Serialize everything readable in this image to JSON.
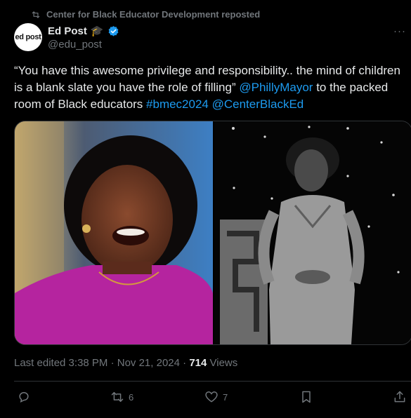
{
  "repost": {
    "text": "Center for Black Educator Development reposted",
    "icon": "repost-icon"
  },
  "author": {
    "avatar_text": "ed post",
    "name": "Ed Post",
    "badge_icon": "graduation-cap-icon",
    "handle": "@edu_post",
    "verified_color": "#1d9bf0"
  },
  "more_label": "···",
  "tweet": {
    "text_part1": "“You have this awesome privilege and responsibility.. the mind of children is a blank slate you have the role of filling” ",
    "mention1": "@PhillyMayor",
    "text_part2": " to the packed room of Black educators ",
    "hashtag": "#bmec2024",
    "text_part3": " ",
    "mention2": "@CenterBlackEd"
  },
  "meta": {
    "edited": "Last edited 3:38 PM · Nov 21, 2024 · ",
    "views_count": "714",
    "views_label": " Views"
  },
  "actions": {
    "reply_count": "",
    "repost_count": "6",
    "like_count": "7"
  },
  "colors": {
    "link": "#1d9bf0",
    "muted": "#71767b",
    "background": "#000000"
  }
}
